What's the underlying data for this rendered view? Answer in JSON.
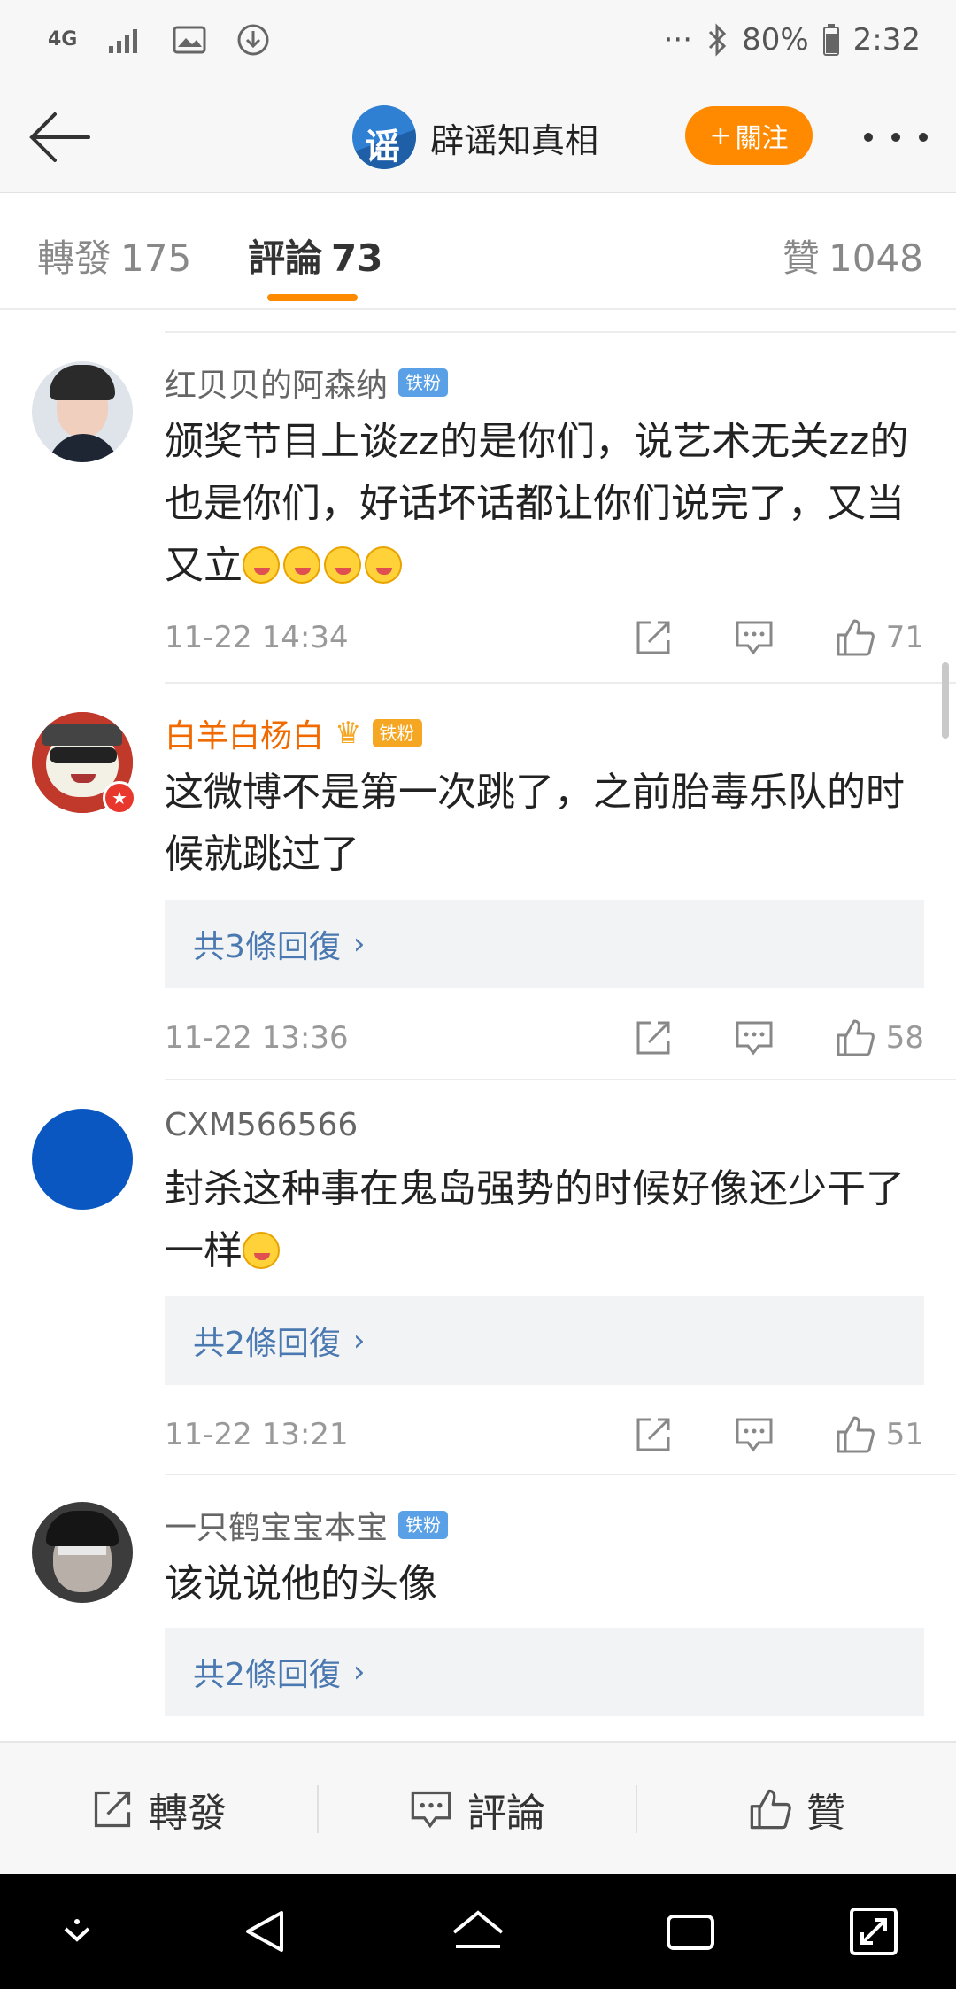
{
  "status_bar": {
    "network": "4G",
    "dots": "···",
    "battery": "80%",
    "time": "2:32"
  },
  "header": {
    "account_name": "辟谣知真相",
    "follow_label": "關注",
    "follow_plus": "+",
    "avatar_text": "谣"
  },
  "tabs": [
    {
      "label": "轉發",
      "count": "175"
    },
    {
      "label": "評論",
      "count": "73"
    },
    {
      "label": "贊",
      "count": "1048"
    }
  ],
  "comments": [
    {
      "name": "红贝贝的阿森纳",
      "badge": "铁粉",
      "text": "颁奖节目上谈zz的是你们，说艺术无关zz的也是你们，好话坏话都让你们说完了，又当又立",
      "emoji_count": 4,
      "time": "11-22 14:34",
      "likes": "71"
    },
    {
      "name": "白羊白杨白",
      "badge": "铁粉",
      "text": "这微博不是第一次跳了，之前胎毒乐队的时候就跳过了",
      "replies": "共3條回復",
      "time": "11-22 13:36",
      "likes": "58"
    },
    {
      "name": "CXM566566",
      "text": "封杀这种事在鬼岛强势的时候好像还少干了一样",
      "replies": "共2條回復",
      "time": "11-22 13:21",
      "likes": "51"
    },
    {
      "name": "一只鹤宝宝本宝",
      "badge": "铁粉",
      "text": "该说说他的头像",
      "replies": "共2條回復"
    }
  ],
  "reply_chevron": "›",
  "bottom_bar": {
    "repost": "轉發",
    "comment": "評論",
    "like": "贊"
  },
  "colors": {
    "accent": "#ff8a00",
    "link": "#4a78b0",
    "vip_name": "#f06a00",
    "fan_badge": "#5aa0e6"
  }
}
